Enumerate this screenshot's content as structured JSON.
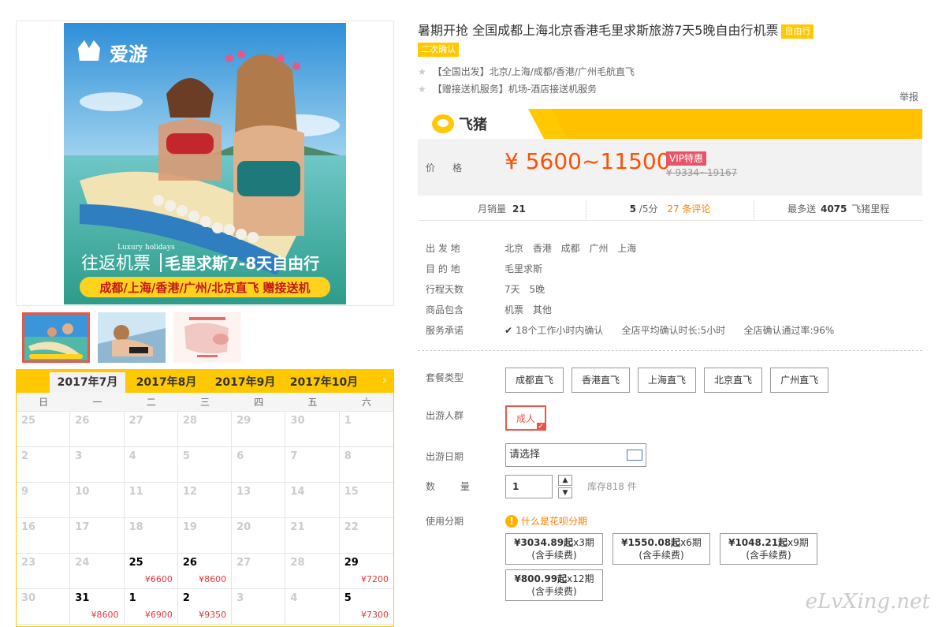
{
  "left": {
    "banner": {
      "logo_text": "爱游",
      "sub_en": "Luxury holidays",
      "headline_a": "往返机票",
      "headline_b": "毛里求斯7-8天自由行",
      "strip": "成都/上海/香港/广州/北京直飞 赠接送机"
    },
    "calendar": {
      "tabs": [
        "2017年7月",
        "2017年8月",
        "2017年9月",
        "2017年10月"
      ],
      "next": "›",
      "weekdays": [
        "日",
        "一",
        "二",
        "三",
        "四",
        "五",
        "六"
      ],
      "rows": [
        [
          {
            "d": "25"
          },
          {
            "d": "26"
          },
          {
            "d": "27"
          },
          {
            "d": "28"
          },
          {
            "d": "29"
          },
          {
            "d": "30"
          },
          {
            "d": "1"
          }
        ],
        [
          {
            "d": "2"
          },
          {
            "d": "3"
          },
          {
            "d": "4"
          },
          {
            "d": "5"
          },
          {
            "d": "6"
          },
          {
            "d": "7"
          },
          {
            "d": "8"
          }
        ],
        [
          {
            "d": "9"
          },
          {
            "d": "10"
          },
          {
            "d": "11"
          },
          {
            "d": "12"
          },
          {
            "d": "13"
          },
          {
            "d": "14"
          },
          {
            "d": "15"
          }
        ],
        [
          {
            "d": "16"
          },
          {
            "d": "17"
          },
          {
            "d": "18"
          },
          {
            "d": "19"
          },
          {
            "d": "20"
          },
          {
            "d": "21"
          },
          {
            "d": "22"
          }
        ],
        [
          {
            "d": "23"
          },
          {
            "d": "24"
          },
          {
            "d": "25",
            "p": "¥6600"
          },
          {
            "d": "26",
            "p": "¥8600"
          },
          {
            "d": "27"
          },
          {
            "d": "28"
          },
          {
            "d": "29",
            "p": "¥7200"
          }
        ],
        [
          {
            "d": "30"
          },
          {
            "d": "31",
            "p": "¥8600"
          },
          {
            "d": "1",
            "p": "¥6900"
          },
          {
            "d": "2",
            "p": "¥9350"
          },
          {
            "d": "3"
          },
          {
            "d": "4"
          },
          {
            "d": "5",
            "p": "¥7300"
          }
        ]
      ]
    }
  },
  "product": {
    "title": "暑期开抢 全国成都上海北京香港毛里求斯旅游7天5晚自由行机票",
    "tag1": "自由行",
    "tag2": "二次确认",
    "feat1": "【全国出发】北京/上海/成都/香港/广州毛航直飞",
    "feat2": "【赠接送机服务】机场-酒店接送机服务",
    "report": "举报"
  },
  "price": {
    "brand": "飞猪",
    "label": "价格",
    "range": "¥ 5600~11500",
    "vip": "VIP特惠",
    "original": "¥ 9334~19167"
  },
  "stats": {
    "monthly_label": "月销量",
    "monthly_value": "21",
    "score": "5",
    "score_unit": "/5分",
    "reviews": "27 条评论",
    "miles_prefix": "最多送",
    "miles_value": "4075",
    "miles_suffix": "飞猪里程"
  },
  "info": [
    {
      "k": "出 发 地",
      "v": "北京 香港 成都 广州 上海"
    },
    {
      "k": "目 的 地",
      "v": "毛里求斯"
    },
    {
      "k": "行程天数",
      "v": "7天 5晚"
    },
    {
      "k": "商品包含",
      "v": "机票 其他"
    },
    {
      "k": "服务承诺",
      "v": "18个工作小时内确认    全店平均确认时长:5小时    全店确认通过率:96%"
    }
  ],
  "options": {
    "package_label": "套餐类型",
    "packages": [
      "成都直飞",
      "香港直飞",
      "上海直飞",
      "北京直飞",
      "广州直飞"
    ],
    "people_label": "出游人群",
    "people": "成人",
    "date_label": "出游日期",
    "date_placeholder": "请选择",
    "qty_label": "数 量",
    "qty_value": "1",
    "stock": "库存818 件",
    "install_label": "使用分期",
    "huabei": "什么是花呗分期",
    "installments": [
      {
        "amount": "¥3034.89起",
        "period": "x3期",
        "note": "(含手续费)"
      },
      {
        "amount": "¥1550.08起",
        "period": "x6期",
        "note": "(含手续费)"
      },
      {
        "amount": "¥1048.21起",
        "period": "x9期",
        "note": "(含手续费)"
      },
      {
        "amount": "¥800.99起",
        "period": "x12期",
        "note": "(含手续费)"
      }
    ]
  },
  "watermark": "eLvXing.net"
}
